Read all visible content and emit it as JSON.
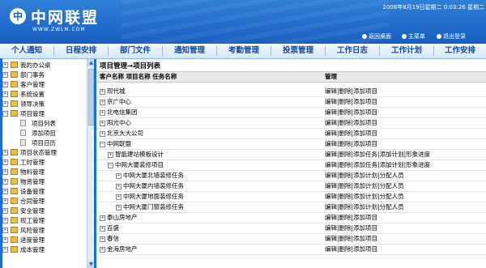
{
  "header": {
    "logo_mark": "中",
    "logo_text": "中网联盟",
    "logo_url": "WWW.ZWLM.COM",
    "datetime": "2008年8月19日星期二 0:03:26 星期二",
    "links": [
      "返回桌面",
      "主菜单",
      "退出登录"
    ]
  },
  "nav": [
    "个人通知",
    "日程安排",
    "部门文件",
    "通知管理",
    "考勤管理",
    "投票管理",
    "工作日志",
    "工作计划",
    "工作安排"
  ],
  "sidebar": {
    "items": [
      {
        "label": "我的办公桌"
      },
      {
        "label": "部门事务"
      },
      {
        "label": "客户管理"
      },
      {
        "label": "系统设置"
      },
      {
        "label": "领导决策"
      },
      {
        "label": "项目管理"
      },
      {
        "label": "项目列表",
        "sub": true
      },
      {
        "label": "添加项目",
        "sub": true
      },
      {
        "label": "项目日历",
        "sub": true
      },
      {
        "label": "项目状态管理"
      },
      {
        "label": "工时管理"
      },
      {
        "label": "物料管理"
      },
      {
        "label": "物资管理"
      },
      {
        "label": "设备管理"
      },
      {
        "label": "合同管理"
      },
      {
        "label": "安全管理"
      },
      {
        "label": "现工管理"
      },
      {
        "label": "风险管理"
      },
      {
        "label": "进度管理"
      },
      {
        "label": "成本管理"
      }
    ]
  },
  "main": {
    "breadcrumb": "项目管理→项目列表",
    "col_left": "客户名称 项目名称 任务名称",
    "col_right": "管理",
    "rows": [
      {
        "name": "现代城",
        "level": 0,
        "actions": "编辑|删除|添加项目"
      },
      {
        "name": "京广中心",
        "level": 0,
        "actions": "编辑|删除|添加项目"
      },
      {
        "name": "北电信集团",
        "level": 0,
        "actions": "编辑|删除|添加项目"
      },
      {
        "name": "阳光中心",
        "level": 0,
        "actions": "编辑|删除|添加项目"
      },
      {
        "name": "北京大大公司",
        "level": 0,
        "actions": "编辑|删除|添加项目"
      },
      {
        "name": "中网联盟",
        "level": 0,
        "actions": "编辑|删除|添加项目"
      },
      {
        "name": "智能建站模板设计",
        "level": 1,
        "actions": "编辑|删除|添加任务|添加计划|形象进度"
      },
      {
        "name": "中网大厦装修项目",
        "level": 1,
        "actions": "编辑|删除|添加任务|添加计划|形象进度"
      },
      {
        "name": "中网大厦北墙装修任务",
        "level": 2,
        "actions": "编辑|删除|添加计划|分配人员"
      },
      {
        "name": "中网大厦内墙装修任务",
        "level": 2,
        "actions": "编辑|删除|添加计划|分配人员"
      },
      {
        "name": "中网大厦地面装修任务",
        "level": 2,
        "actions": "编辑|删除|添加计划|分配人员"
      },
      {
        "name": "中网大厦门窗装修任务",
        "level": 2,
        "actions": "编辑|删除|添加计划|分配人员"
      },
      {
        "name": "泰山房地产",
        "level": 0,
        "actions": "编辑|删除|添加项目"
      },
      {
        "name": "百盛",
        "level": 0,
        "actions": "编辑|删除|添加项目"
      },
      {
        "name": "春信",
        "level": 0,
        "actions": "编辑|删除|添加项目"
      },
      {
        "name": "金海房地产",
        "level": 0,
        "actions": "编辑|删除|添加项目"
      }
    ]
  }
}
